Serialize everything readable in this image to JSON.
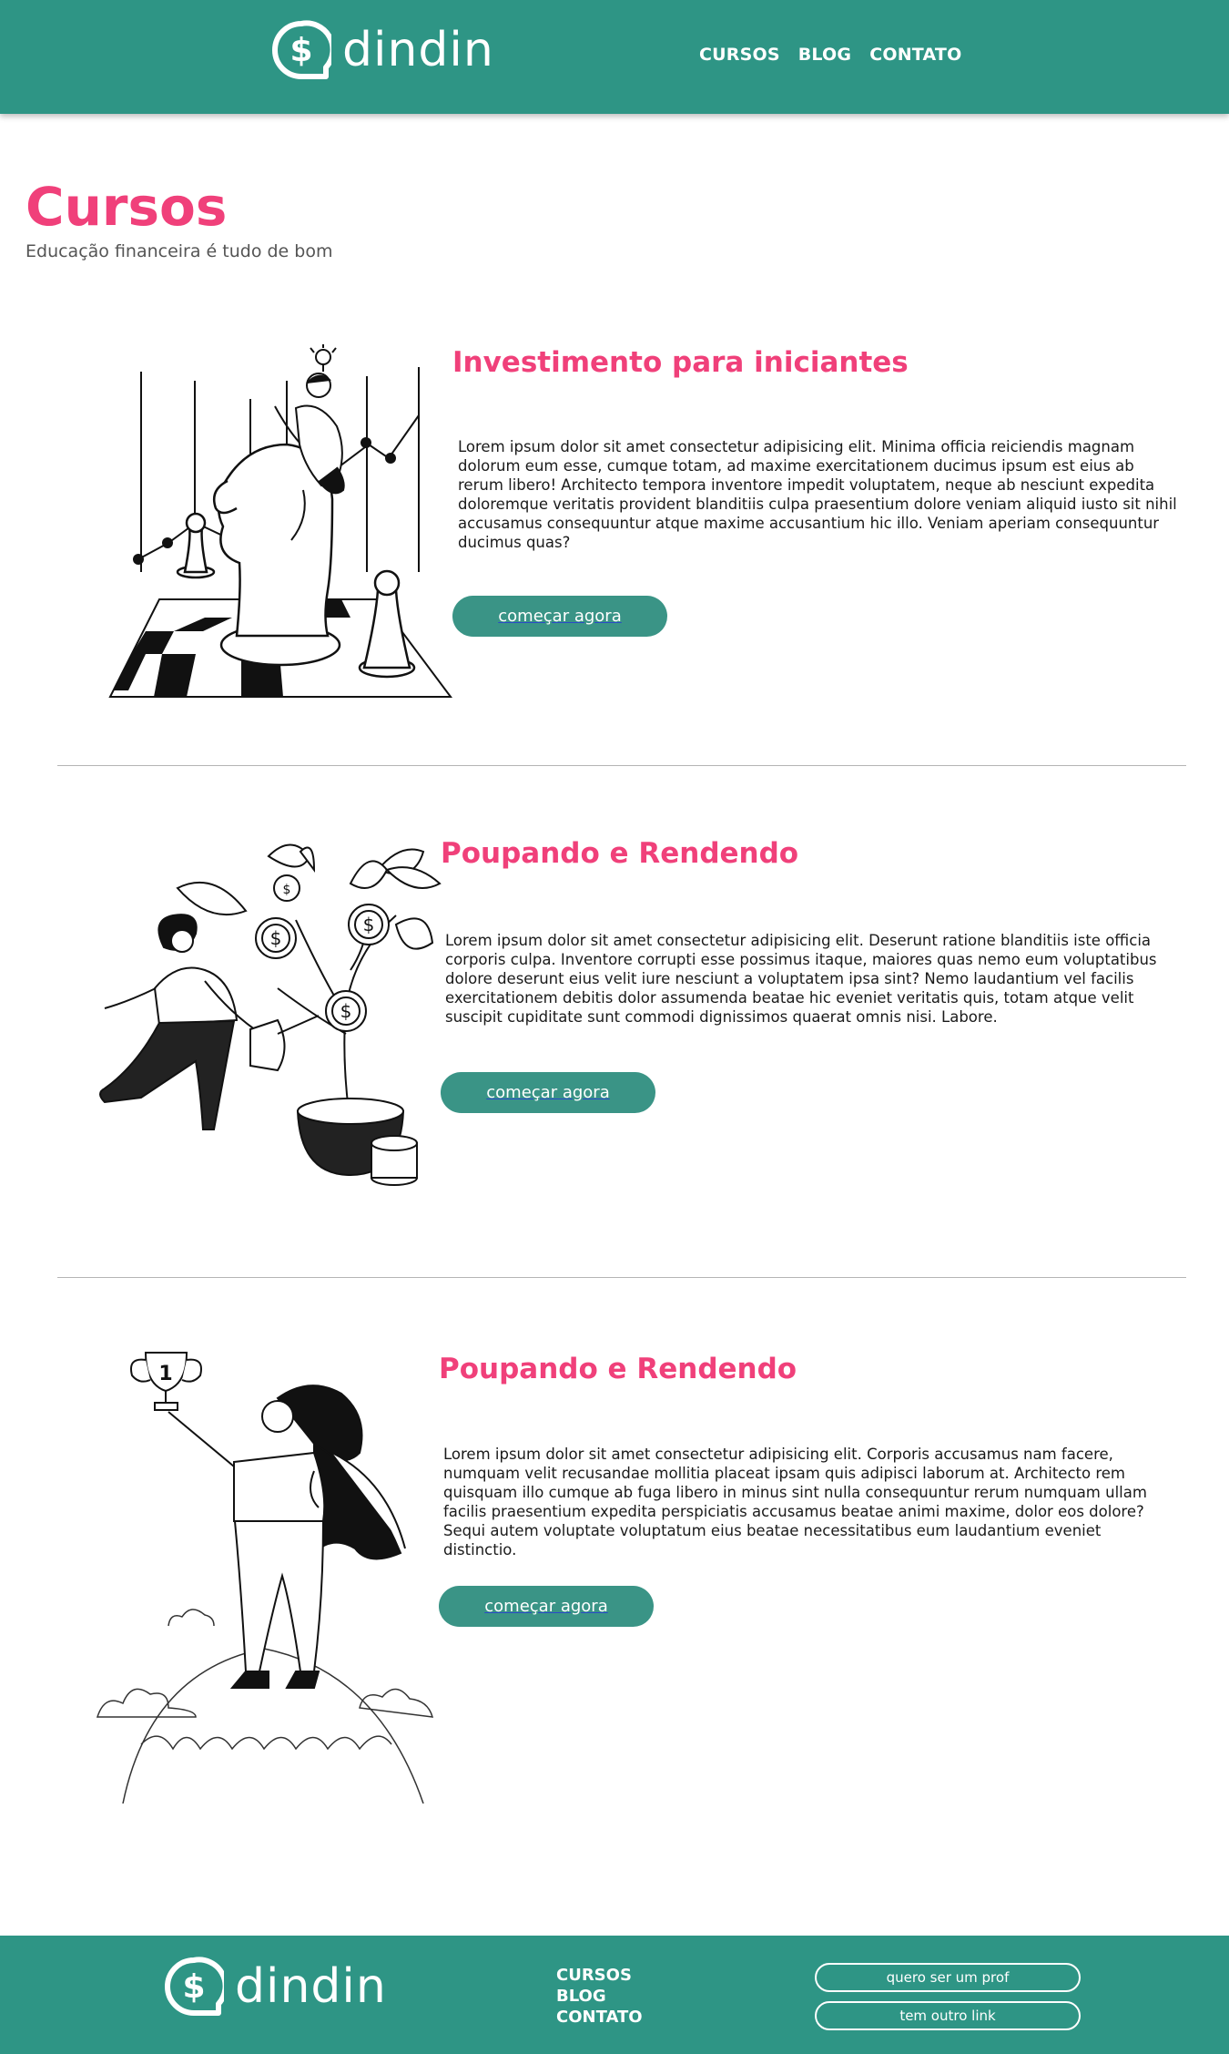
{
  "header": {
    "logo_text": "dindin",
    "nav": [
      "CURSOS",
      "BLOG",
      "CONTATO"
    ]
  },
  "page": {
    "title": "Cursos",
    "subtitle": "Educação financeira é tudo de bom"
  },
  "courses": [
    {
      "title": "Investimento para iniciantes",
      "description": "Lorem ipsum dolor sit amet consectetur adipisicing elit. Minima officia reiciendis magnam dolorum eum esse, cumque totam, ad maxime exercitationem ducimus ipsum est eius ab rerum libero! Architecto tempora inventore impedit voluptatem, neque ab nesciunt expedita doloremque veritatis provident blanditiis culpa praesentium dolore veniam aliquid iusto sit nihil accusamus consequuntur atque maxime accusantium hic illo. Veniam aperiam consequuntur ducimus quas?",
      "button": "começar agora",
      "illustration": "chess-investor-illustration"
    },
    {
      "title": "Poupando e Rendendo",
      "description": "Lorem ipsum dolor sit amet consectetur adipisicing elit. Deserunt ratione blanditiis iste officia corporis culpa. Inventore corrupti esse possimus itaque, maiores quas nemo eum voluptatibus dolore deserunt eius velit iure nesciunt a voluptatem ipsa sint? Nemo laudantium vel facilis exercitationem debitis dolor assumenda beatae hic eveniet veritatis quis, totam atque velit suscipit cupiditate sunt commodi dignissimos quaerat omnis nisi. Labore.",
      "button": "começar agora",
      "illustration": "money-tree-illustration"
    },
    {
      "title": "Poupando e Rendendo",
      "description": "Lorem ipsum dolor sit amet consectetur adipisicing elit. Corporis accusamus nam facere, numquam velit recusandae mollitia placeat ipsam quis adipisci laborum at. Architecto rem quisquam illo cumque ab fuga libero in minus sint nulla consequuntur rerum numquam ullam facilis praesentium expedita perspiciatis accusamus beatae animi maxime, dolor eos dolore? Sequi autem voluptate voluptatum eius beatae necessitatibus eum laudantium eveniet distinctio.",
      "button": "começar agora",
      "illustration": "trophy-winner-illustration"
    }
  ],
  "footer": {
    "logo_text": "dindin",
    "nav": [
      "CURSOS",
      "BLOG",
      "CONTATO"
    ],
    "links": [
      "quero ser um prof",
      "tem outro link"
    ]
  },
  "colors": {
    "brand": "#2e9585",
    "accent_pink": "#f0407a",
    "button": "#3a9486"
  }
}
